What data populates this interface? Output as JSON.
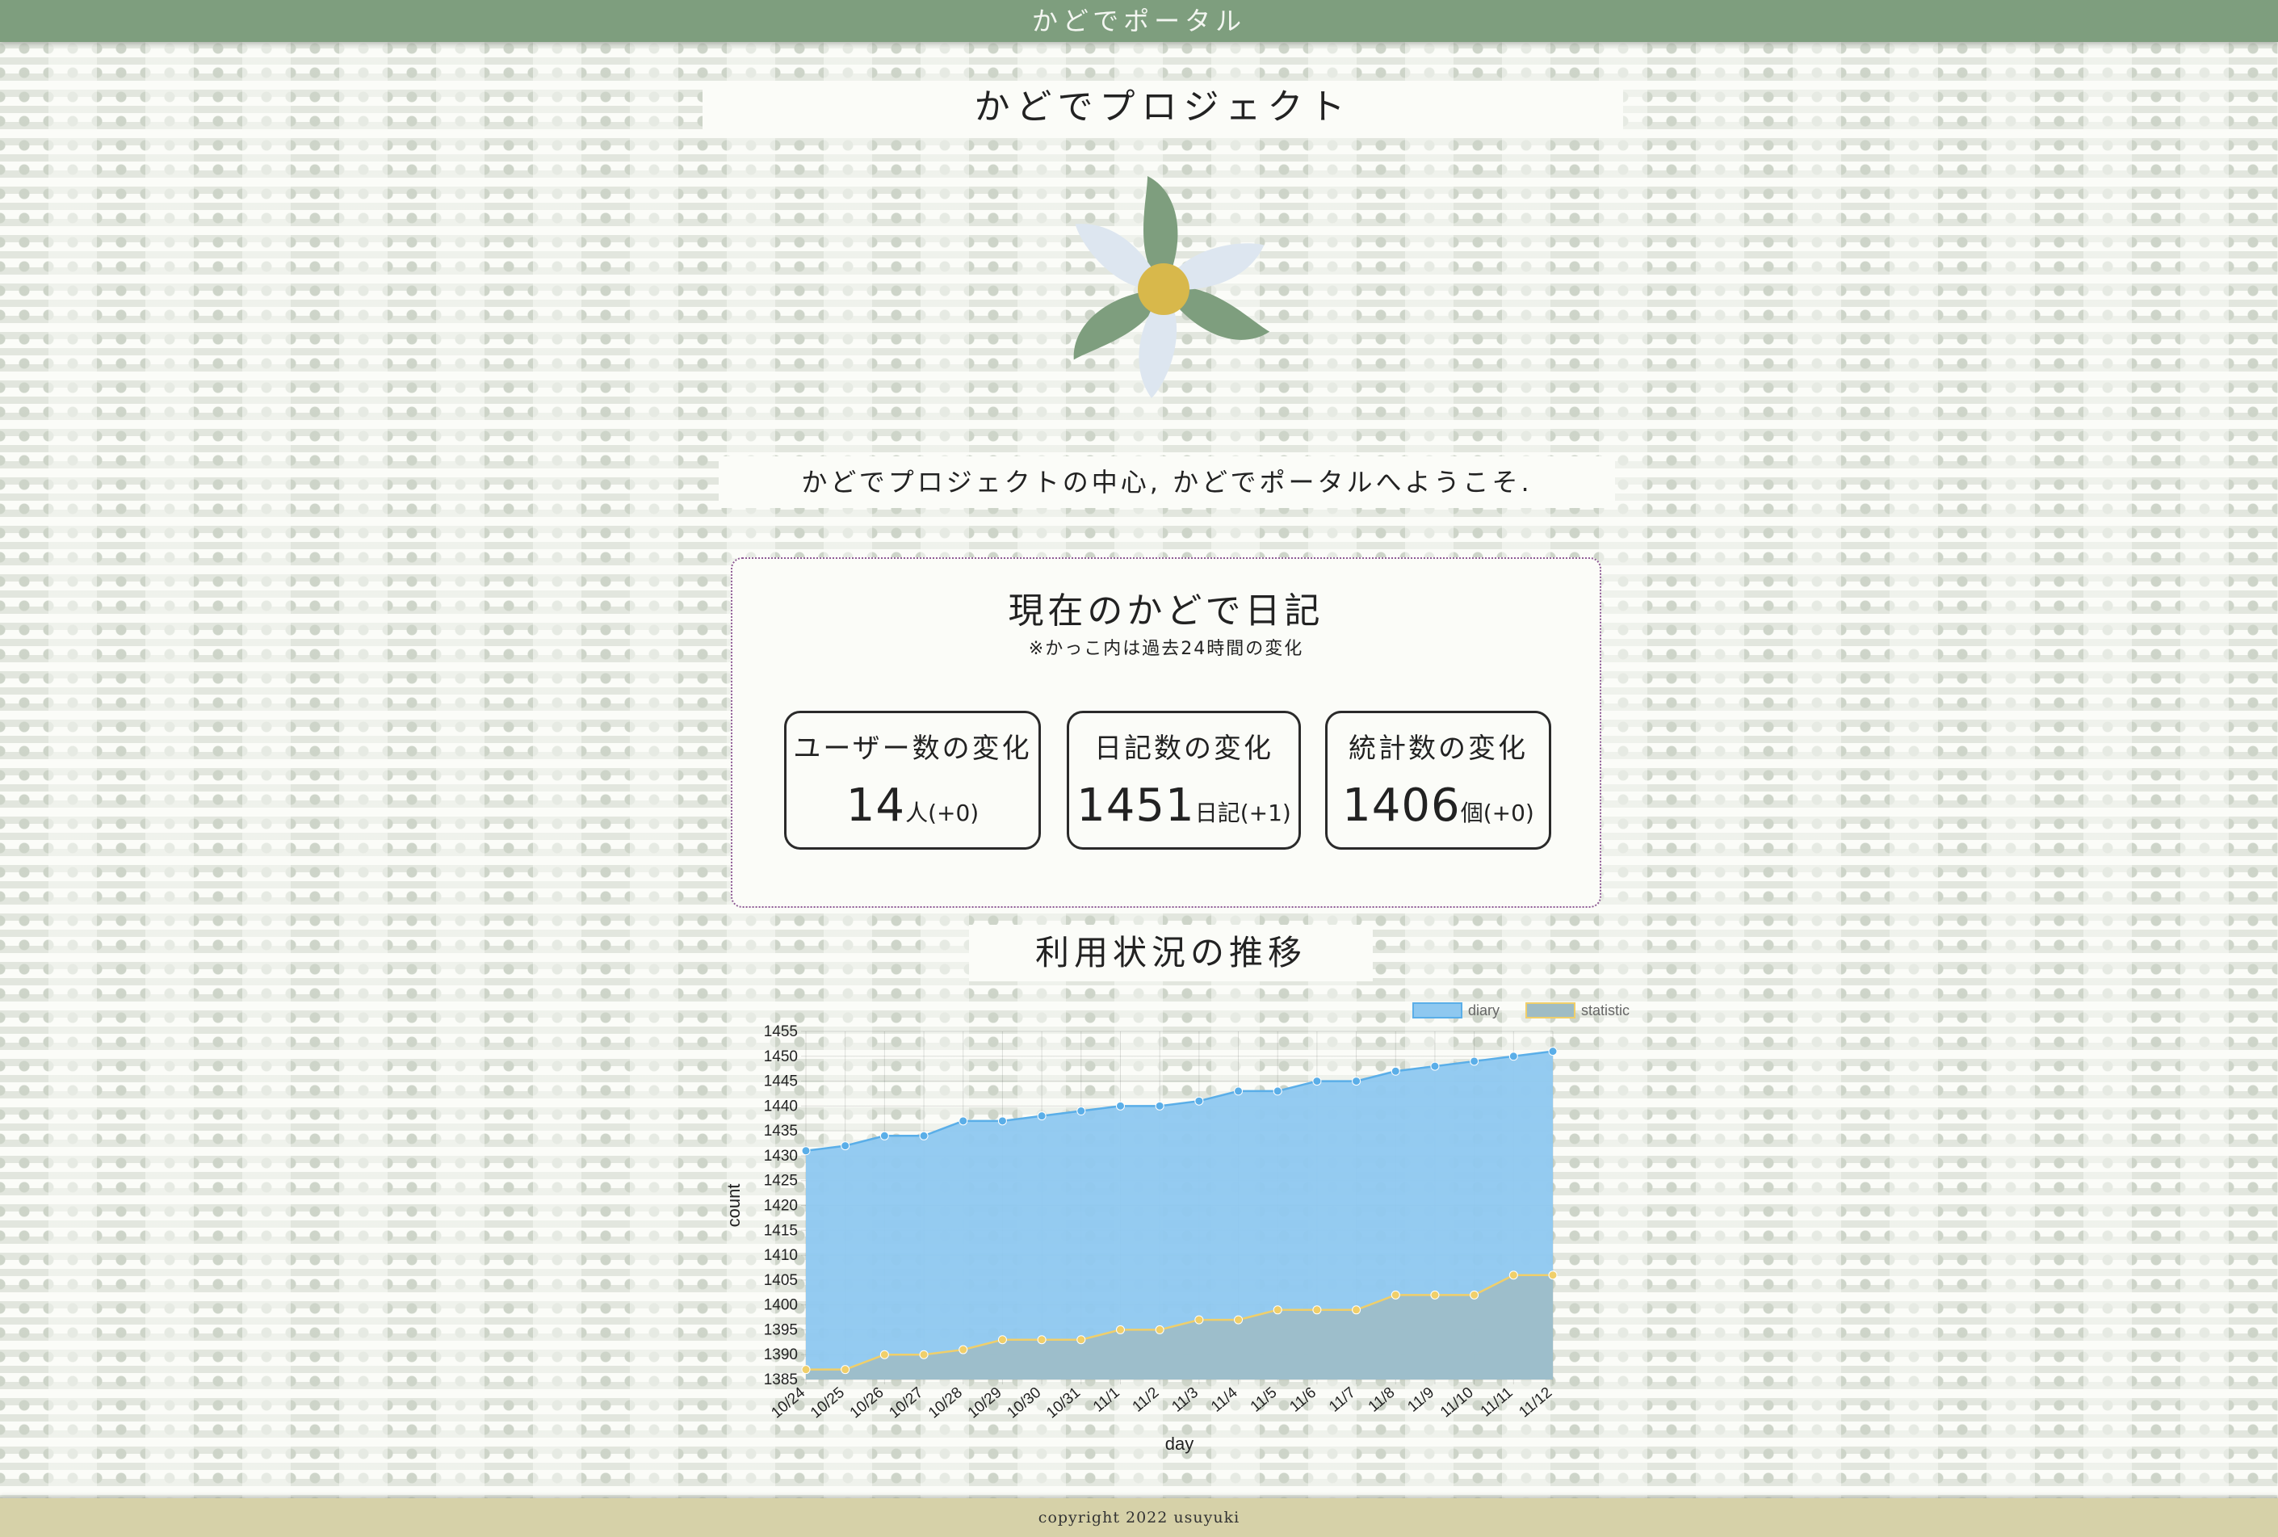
{
  "header": {
    "title": "かどでポータル"
  },
  "hero": {
    "title": "かどでプロジェクト",
    "welcome": "かどでプロジェクトの中心, かどでポータルへようこそ."
  },
  "stats": {
    "title": "現在のかどで日記",
    "note": "※かっこ内は過去24時間の変化",
    "items": [
      {
        "label": "ユーザー数の変化",
        "value": "14",
        "unit": "人",
        "delta": "(+0)"
      },
      {
        "label": "日記数の変化",
        "value": "1451",
        "unit": "日記",
        "delta": "(+1)"
      },
      {
        "label": "統計数の変化",
        "value": "1406",
        "unit": "個",
        "delta": "(+0)"
      }
    ]
  },
  "usage": {
    "title": "利用状況の推移"
  },
  "chart_data": {
    "type": "area",
    "xlabel": "day",
    "ylabel": "count",
    "ylim": [
      1385,
      1455
    ],
    "yticks": [
      1385,
      1390,
      1395,
      1400,
      1405,
      1410,
      1415,
      1420,
      1425,
      1430,
      1435,
      1440,
      1445,
      1450,
      1455
    ],
    "grid": true,
    "legend_position": "top-right",
    "categories": [
      "10/24",
      "10/25",
      "10/26",
      "10/27",
      "10/28",
      "10/29",
      "10/30",
      "10/31",
      "11/1",
      "11/2",
      "11/3",
      "11/4",
      "11/5",
      "11/6",
      "11/7",
      "11/8",
      "11/9",
      "11/10",
      "11/11",
      "11/12"
    ],
    "series": [
      {
        "name": "diary",
        "color": "#5aaee8",
        "fill": "#8ec8f0",
        "values": [
          1431,
          1432,
          1434,
          1434,
          1437,
          1437,
          1438,
          1439,
          1440,
          1440,
          1441,
          1443,
          1443,
          1445,
          1445,
          1447,
          1448,
          1449,
          1450,
          1451
        ]
      },
      {
        "name": "statistic",
        "color": "#f0cf6a",
        "fill": "#9fbcc4",
        "values": [
          1387,
          1387,
          1390,
          1390,
          1391,
          1393,
          1393,
          1393,
          1395,
          1395,
          1397,
          1397,
          1399,
          1399,
          1399,
          1402,
          1402,
          1402,
          1406,
          1406
        ]
      }
    ]
  },
  "footer": {
    "copyright": "copyright 2022 usuyuki"
  },
  "colors": {
    "header_bg": "#7e9e7e",
    "footer_bg": "#d6d1a8",
    "card_border": "#8e5b95",
    "logo_leaf": "#7e9e7e",
    "logo_petal": "#dde6f0",
    "logo_center": "#d8b84b"
  }
}
